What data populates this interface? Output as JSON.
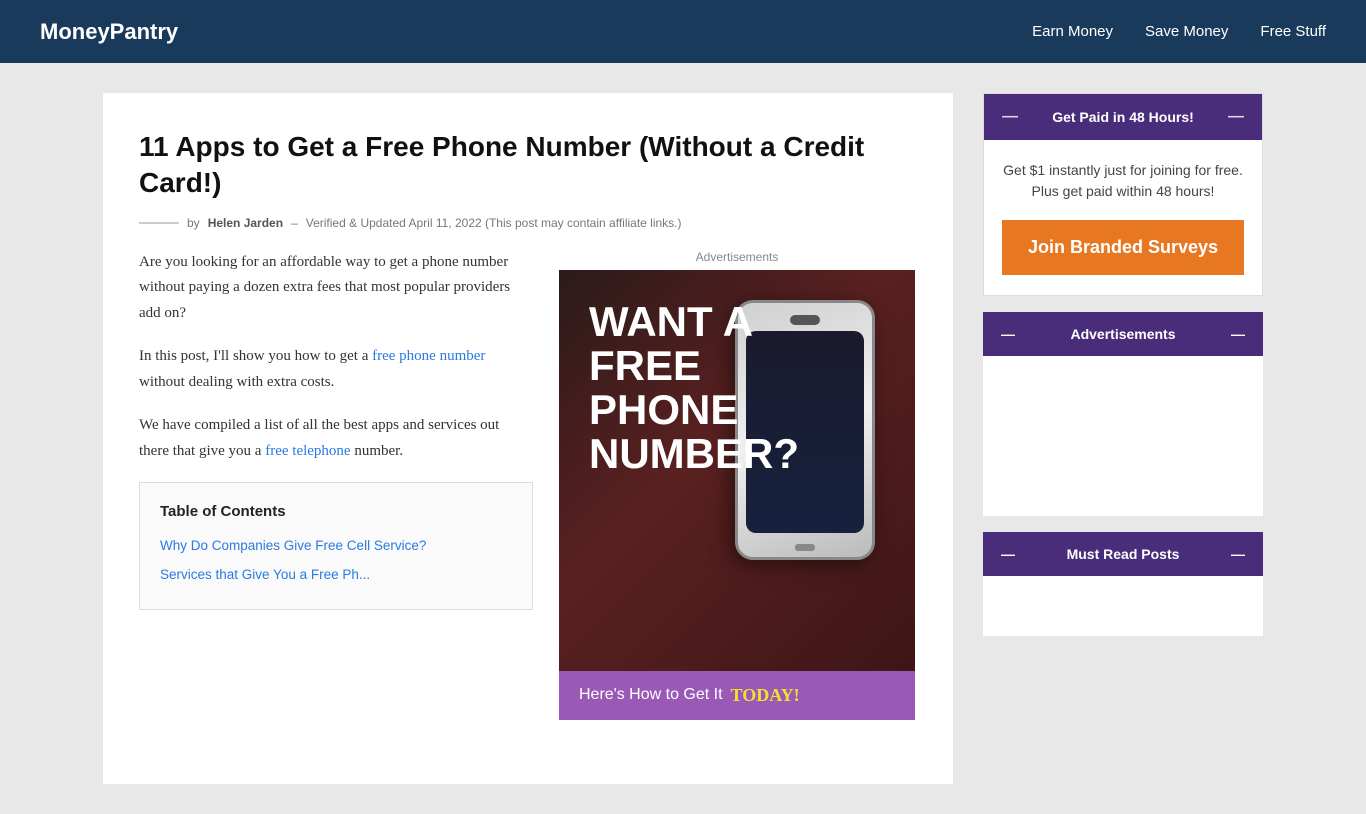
{
  "header": {
    "logo": "MoneyPantry",
    "nav": [
      {
        "label": "Earn Money",
        "href": "#"
      },
      {
        "label": "Save Money",
        "href": "#"
      },
      {
        "label": "Free Stuff",
        "href": "#"
      }
    ]
  },
  "article": {
    "title": "11 Apps to Get a Free Phone Number (Without a Credit Card!)",
    "meta_line": "—",
    "meta_prefix": "by",
    "author": "Helen Jarden",
    "meta_separator": "–",
    "meta_verified": "Verified & Updated April 11, 2022 (This post may contain affiliate links.)",
    "ads_label": "Advertisements",
    "para1": "Are you looking for an affordable way to get a phone number without paying a dozen extra fees that most popular providers add on?",
    "para2_prefix": "In this post, I'll show you how to get a ",
    "para2_link": "free phone number",
    "para2_suffix": " without dealing with extra costs.",
    "para3_prefix": "We have compiled a list of all the best apps and services out there that give you a ",
    "para3_link": "free telephone",
    "para3_suffix": " number.",
    "phone_ad": {
      "headline_line1": "WANT A",
      "headline_line2": "FREE",
      "headline_line3": "PHONE",
      "headline_line4": "NUMBER?",
      "cta_prefix": "Here's How to Get It",
      "cta_highlight": "TODAY!"
    },
    "toc": {
      "title": "Table of Contents",
      "items": [
        {
          "label": "Why Do Companies Give Free Cell Service?"
        },
        {
          "label": "Services that Give You a Free Ph..."
        }
      ]
    }
  },
  "sidebar": {
    "branded_widget": {
      "header": "— Get Paid in 48 Hours! —",
      "header_em1": "—",
      "header_label": "Get Paid in 48 Hours!",
      "header_em2": "—",
      "body_text": "Get $1 instantly just for joining for free. Plus get paid within 48 hours!",
      "cta_label": "Join Branded Surveys"
    },
    "ads_widget": {
      "header_em1": "—",
      "header_label": "Advertisements",
      "header_em2": "—"
    },
    "must_read_widget": {
      "header_em1": "—",
      "header_label": "Must Read Posts",
      "header_em2": "—"
    }
  }
}
